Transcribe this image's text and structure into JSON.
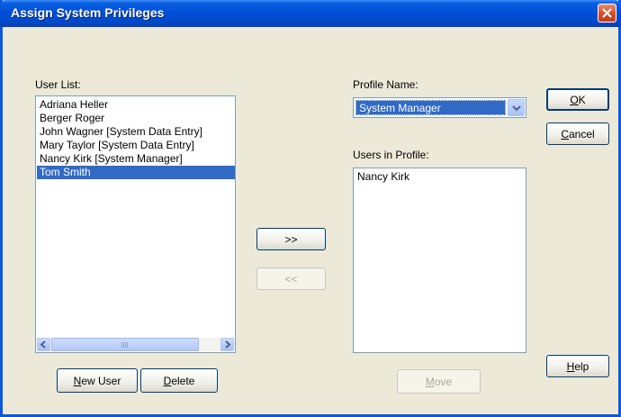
{
  "window": {
    "title": "Assign System Privileges"
  },
  "user_list": {
    "label": "User List:",
    "items": [
      {
        "label": "Adriana Heller",
        "selected": false
      },
      {
        "label": "Berger Roger",
        "selected": false
      },
      {
        "label": "John Wagner [System Data Entry]",
        "selected": false
      },
      {
        "label": "Mary Taylor [System Data Entry]",
        "selected": false
      },
      {
        "label": "Nancy Kirk [System Manager]",
        "selected": false
      },
      {
        "label": "Tom Smith",
        "selected": true
      }
    ]
  },
  "buttons": {
    "add": ">>",
    "remove": "<<",
    "new_user": {
      "prefix": "",
      "accel": "N",
      "rest": "ew User"
    },
    "delete": {
      "prefix": "",
      "accel": "D",
      "rest": "elete"
    },
    "ok": {
      "prefix": "",
      "accel": "O",
      "rest": "K"
    },
    "cancel": {
      "prefix": "",
      "accel": "C",
      "rest": "ancel"
    },
    "help": {
      "prefix": "",
      "accel": "H",
      "rest": "elp"
    },
    "move": {
      "prefix": "",
      "accel": "M",
      "rest": "ove"
    }
  },
  "profile": {
    "label": "Profile Name:",
    "selected": "System Manager"
  },
  "users_in_profile": {
    "label": "Users in Profile:",
    "items": [
      {
        "label": "Nancy Kirk"
      }
    ]
  }
}
